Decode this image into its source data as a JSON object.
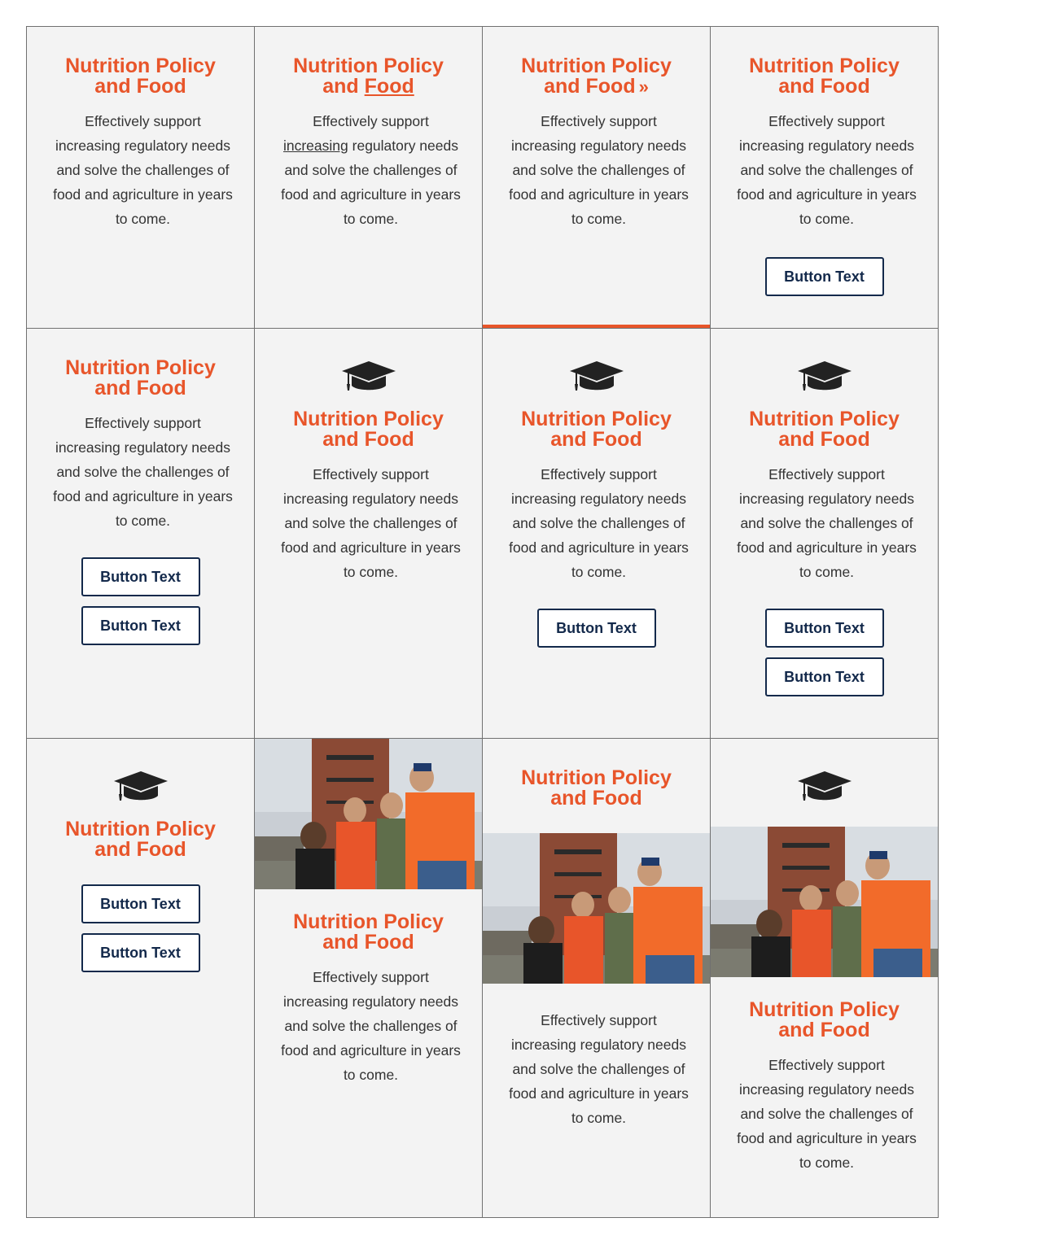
{
  "card": {
    "title_line1": "Nutrition Policy",
    "title_line2_prefix": "and ",
    "title_line2_word": "Food",
    "title_line2": "and Food",
    "chevron": "»",
    "text_line1_word": "Effectively support",
    "text_increasing": "increasing",
    "text_after_increasing": " regulatory needs",
    "text": "Effectively support increasing regulatory needs and solve the challenges of food and agriculture in years to come.",
    "text_rest": "and solve the challenges of food and agriculture in years to come.",
    "button_label": "Button Text"
  },
  "icons": {
    "cap": "graduation-cap-icon",
    "photo": "students-photo"
  },
  "colors": {
    "title": "#e8552a",
    "text": "#333333",
    "button_border": "#13294b",
    "card_bg": "#f3f3f3",
    "border": "#707070",
    "accent_bar": "#e8552a"
  }
}
